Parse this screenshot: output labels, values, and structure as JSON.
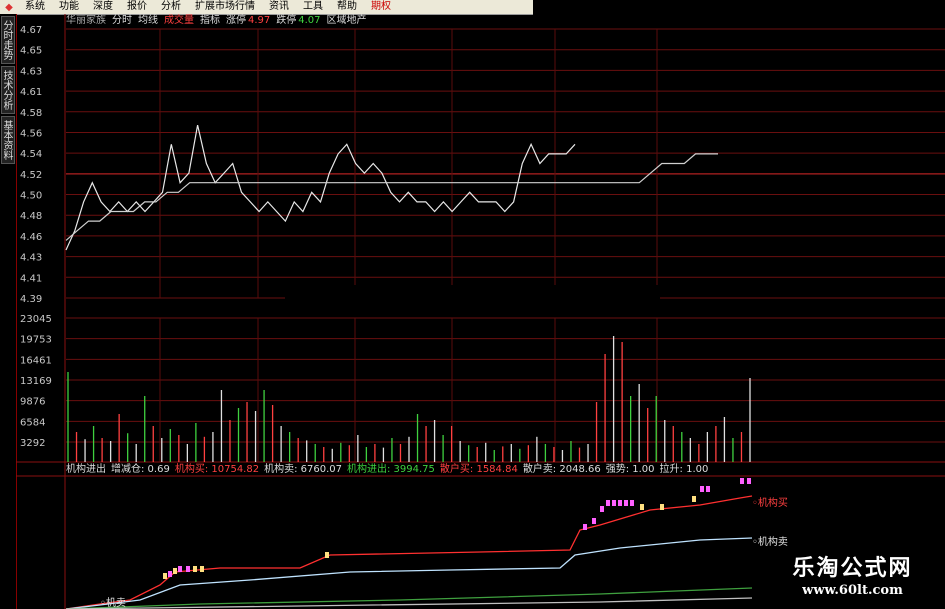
{
  "menu": {
    "items": [
      "系统",
      "功能",
      "深度",
      "报价",
      "分析",
      "扩展市场行情",
      "资讯",
      "工具",
      "帮助",
      "期权"
    ]
  },
  "left_tabs": [
    "分时走势",
    "技术分析",
    "基本资料"
  ],
  "price_panel": {
    "stock_name": "华丽家族",
    "labels": [
      "分时",
      "均线",
      "成交量",
      "指标"
    ],
    "limit_up_label": "涨停",
    "limit_up_value": "4.97",
    "limit_down_label": "跌停",
    "limit_down_value": "4.07",
    "region_label": "区域地产"
  },
  "volume_panel": {
    "items": [
      {
        "label": "机构进出",
        "value": "",
        "color": "#dddddd"
      },
      {
        "label": "增减仓:",
        "value": "0.69",
        "color": "#dddddd"
      },
      {
        "label": "机构买:",
        "value": "10754.82",
        "color": "#ff4040"
      },
      {
        "label": "机构卖:",
        "value": "6760.07",
        "color": "#dddddd"
      },
      {
        "label": "机构进出:",
        "value": "3994.75",
        "color": "#3fd13f"
      },
      {
        "label": "散户买:",
        "value": "1584.84",
        "color": "#ff4040"
      },
      {
        "label": "散户卖:",
        "value": "2048.66",
        "color": "#dddddd"
      },
      {
        "label": "强势:",
        "value": "1.00",
        "color": "#dddddd"
      },
      {
        "label": "拉升:",
        "value": "1.00",
        "color": "#dddddd"
      }
    ]
  },
  "line_labels": {
    "inst_buy": "机构买",
    "inst_sell": "机构卖",
    "retail_sell": "机卖"
  },
  "watermark": {
    "cn": "乐淘公式网",
    "url": "www.60lt.com"
  },
  "chart_data": {
    "type": "line",
    "price_ticks": [
      "4.67",
      "4.65",
      "4.63",
      "4.61",
      "4.58",
      "4.56",
      "4.54",
      "4.52",
      "4.50",
      "4.48",
      "4.46",
      "4.43",
      "4.41",
      "4.39"
    ],
    "price_ylim": [
      4.39,
      4.67
    ],
    "reference_price": 4.52,
    "volume_ticks": [
      "23045",
      "19753",
      "16461",
      "13169",
      "9876",
      "6584",
      "3292"
    ],
    "volume_ylim": [
      0,
      24000
    ],
    "series": [
      {
        "name": "分时",
        "color": "#e8e8e8",
        "values": [
          4.44,
          4.46,
          4.49,
          4.51,
          4.49,
          4.48,
          4.49,
          4.48,
          4.49,
          4.48,
          4.49,
          4.5,
          4.55,
          4.51,
          4.52,
          4.57,
          4.53,
          4.51,
          4.52,
          4.53,
          4.5,
          4.49,
          4.48,
          4.49,
          4.48,
          4.47,
          4.49,
          4.48,
          4.5,
          4.49,
          4.52,
          4.54,
          4.55,
          4.53,
          4.52,
          4.53,
          4.52,
          4.5,
          4.49,
          4.5,
          4.49,
          4.49,
          4.48,
          4.49,
          4.48,
          4.49,
          4.5,
          4.49,
          4.49,
          4.49,
          4.48,
          4.49,
          4.53,
          4.55,
          4.53,
          4.54,
          4.54,
          4.54,
          4.55
        ]
      },
      {
        "name": "均线",
        "color": "#d0d0d0",
        "values": [
          4.45,
          4.46,
          4.47,
          4.47,
          4.48,
          4.48,
          4.48,
          4.49,
          4.49,
          4.5,
          4.5,
          4.51,
          4.51,
          4.51,
          4.51,
          4.51,
          4.51,
          4.51,
          4.51,
          4.51,
          4.51,
          4.51,
          4.51,
          4.51,
          4.51,
          4.51,
          4.51,
          4.51,
          4.51,
          4.51,
          4.51,
          4.51,
          4.51,
          4.51,
          4.51,
          4.51,
          4.51,
          4.51,
          4.51,
          4.51,
          4.51,
          4.51,
          4.51,
          4.51,
          4.51,
          4.51,
          4.51,
          4.51,
          4.51,
          4.51,
          4.51,
          4.51,
          4.52,
          4.53,
          4.53,
          4.53,
          4.54,
          4.54,
          4.54
        ]
      }
    ],
    "volume": [
      {
        "v": 15000,
        "c": "g"
      },
      {
        "v": 5000,
        "c": "r"
      },
      {
        "v": 3800,
        "c": "w"
      },
      {
        "v": 6000,
        "c": "g"
      },
      {
        "v": 4000,
        "c": "r"
      },
      {
        "v": 3500,
        "c": "w"
      },
      {
        "v": 8000,
        "c": "r"
      },
      {
        "v": 4800,
        "c": "g"
      },
      {
        "v": 3000,
        "c": "w"
      },
      {
        "v": 11000,
        "c": "g"
      },
      {
        "v": 6000,
        "c": "r"
      },
      {
        "v": 4000,
        "c": "w"
      },
      {
        "v": 5500,
        "c": "g"
      },
      {
        "v": 4500,
        "c": "r"
      },
      {
        "v": 3000,
        "c": "w"
      },
      {
        "v": 6500,
        "c": "g"
      },
      {
        "v": 4200,
        "c": "r"
      },
      {
        "v": 5000,
        "c": "w"
      },
      {
        "v": 12000,
        "c": "w"
      },
      {
        "v": 7000,
        "c": "r"
      },
      {
        "v": 9000,
        "c": "g"
      },
      {
        "v": 10000,
        "c": "r"
      },
      {
        "v": 8500,
        "c": "w"
      },
      {
        "v": 12000,
        "c": "g"
      },
      {
        "v": 9500,
        "c": "r"
      },
      {
        "v": 6000,
        "c": "w"
      },
      {
        "v": 5000,
        "c": "g"
      },
      {
        "v": 4000,
        "c": "r"
      },
      {
        "v": 3600,
        "c": "w"
      },
      {
        "v": 3000,
        "c": "g"
      },
      {
        "v": 2500,
        "c": "r"
      },
      {
        "v": 2200,
        "c": "w"
      },
      {
        "v": 3200,
        "c": "g"
      },
      {
        "v": 2800,
        "c": "r"
      },
      {
        "v": 4500,
        "c": "w"
      },
      {
        "v": 2500,
        "c": "g"
      },
      {
        "v": 3000,
        "c": "r"
      },
      {
        "v": 2400,
        "c": "w"
      },
      {
        "v": 4000,
        "c": "g"
      },
      {
        "v": 3000,
        "c": "r"
      },
      {
        "v": 4200,
        "c": "w"
      },
      {
        "v": 8000,
        "c": "g"
      },
      {
        "v": 6000,
        "c": "r"
      },
      {
        "v": 7000,
        "c": "w"
      },
      {
        "v": 4500,
        "c": "g"
      },
      {
        "v": 6000,
        "c": "r"
      },
      {
        "v": 3500,
        "c": "w"
      },
      {
        "v": 2800,
        "c": "g"
      },
      {
        "v": 2500,
        "c": "r"
      },
      {
        "v": 3200,
        "c": "w"
      },
      {
        "v": 2000,
        "c": "g"
      },
      {
        "v": 2600,
        "c": "r"
      },
      {
        "v": 3000,
        "c": "w"
      },
      {
        "v": 2200,
        "c": "g"
      },
      {
        "v": 2800,
        "c": "r"
      },
      {
        "v": 4200,
        "c": "w"
      },
      {
        "v": 3000,
        "c": "g"
      },
      {
        "v": 2500,
        "c": "r"
      },
      {
        "v": 2000,
        "c": "w"
      },
      {
        "v": 3500,
        "c": "g"
      },
      {
        "v": 2400,
        "c": "r"
      },
      {
        "v": 3000,
        "c": "w"
      },
      {
        "v": 10000,
        "c": "r"
      },
      {
        "v": 18000,
        "c": "r"
      },
      {
        "v": 21000,
        "c": "w"
      },
      {
        "v": 20000,
        "c": "r"
      },
      {
        "v": 11000,
        "c": "g"
      },
      {
        "v": 13000,
        "c": "w"
      },
      {
        "v": 9000,
        "c": "r"
      },
      {
        "v": 11000,
        "c": "g"
      },
      {
        "v": 7000,
        "c": "w"
      },
      {
        "v": 6000,
        "c": "r"
      },
      {
        "v": 5000,
        "c": "g"
      },
      {
        "v": 4000,
        "c": "w"
      },
      {
        "v": 3000,
        "c": "r"
      },
      {
        "v": 5000,
        "c": "w"
      },
      {
        "v": 6000,
        "c": "r"
      },
      {
        "v": 7500,
        "c": "w"
      },
      {
        "v": 4000,
        "c": "g"
      },
      {
        "v": 5000,
        "c": "r"
      },
      {
        "v": 14000,
        "c": "w"
      }
    ]
  }
}
